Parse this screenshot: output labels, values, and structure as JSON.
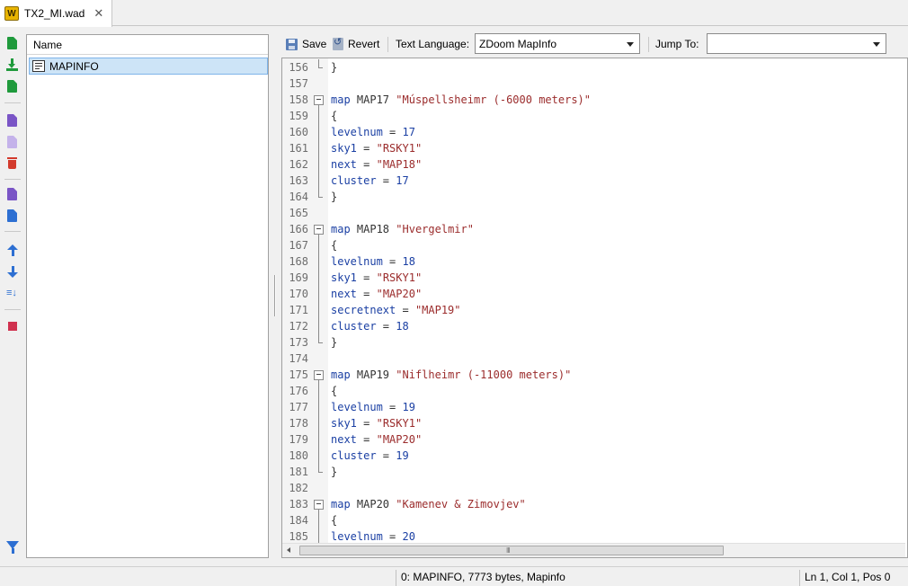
{
  "tab": {
    "title": "TX2_MI.wad",
    "icon": "wad-icon",
    "close_glyph": "✕",
    "wad_letter": "W"
  },
  "list": {
    "column_header": "Name",
    "entries": [
      {
        "name": "MAPINFO",
        "icon": "text-entry-icon",
        "selected": true
      }
    ]
  },
  "toolbar": {
    "save_label": "Save",
    "revert_label": "Revert",
    "text_language_label": "Text Language:",
    "text_language_value": "ZDoom MapInfo",
    "jump_to_label": "Jump To:",
    "jump_to_value": ""
  },
  "editor": {
    "lines": [
      {
        "n": "156",
        "fold": "end",
        "tokens": [
          {
            "t": "}",
            "c": "plain"
          }
        ]
      },
      {
        "n": "157",
        "fold": "none",
        "tokens": []
      },
      {
        "n": "158",
        "fold": "box",
        "tokens": [
          {
            "t": "map",
            "c": "kw"
          },
          {
            "t": " MAP17 ",
            "c": "plain"
          },
          {
            "t": "\"Múspellsheimr (-6000 meters)\"",
            "c": "str"
          }
        ]
      },
      {
        "n": "159",
        "fold": "bar",
        "tokens": [
          {
            "t": "{",
            "c": "plain"
          }
        ]
      },
      {
        "n": "160",
        "fold": "bar",
        "tokens": [
          {
            "t": "levelnum",
            "c": "prop"
          },
          {
            "t": " = ",
            "c": "plain"
          },
          {
            "t": "17",
            "c": "num"
          }
        ]
      },
      {
        "n": "161",
        "fold": "bar",
        "tokens": [
          {
            "t": "sky1",
            "c": "prop"
          },
          {
            "t": " = ",
            "c": "plain"
          },
          {
            "t": "\"RSKY1\"",
            "c": "str"
          }
        ]
      },
      {
        "n": "162",
        "fold": "bar",
        "tokens": [
          {
            "t": "next",
            "c": "prop"
          },
          {
            "t": " = ",
            "c": "plain"
          },
          {
            "t": "\"MAP18\"",
            "c": "str"
          }
        ]
      },
      {
        "n": "163",
        "fold": "bar",
        "tokens": [
          {
            "t": "cluster",
            "c": "prop"
          },
          {
            "t": " = ",
            "c": "plain"
          },
          {
            "t": "17",
            "c": "num"
          }
        ]
      },
      {
        "n": "164",
        "fold": "end",
        "tokens": [
          {
            "t": "}",
            "c": "plain"
          }
        ]
      },
      {
        "n": "165",
        "fold": "none",
        "tokens": []
      },
      {
        "n": "166",
        "fold": "box",
        "tokens": [
          {
            "t": "map",
            "c": "kw"
          },
          {
            "t": " MAP18 ",
            "c": "plain"
          },
          {
            "t": "\"Hvergelmir\"",
            "c": "str"
          }
        ]
      },
      {
        "n": "167",
        "fold": "bar",
        "tokens": [
          {
            "t": "{",
            "c": "plain"
          }
        ]
      },
      {
        "n": "168",
        "fold": "bar",
        "tokens": [
          {
            "t": "levelnum",
            "c": "prop"
          },
          {
            "t": " = ",
            "c": "plain"
          },
          {
            "t": "18",
            "c": "num"
          }
        ]
      },
      {
        "n": "169",
        "fold": "bar",
        "tokens": [
          {
            "t": "sky1",
            "c": "prop"
          },
          {
            "t": " = ",
            "c": "plain"
          },
          {
            "t": "\"RSKY1\"",
            "c": "str"
          }
        ]
      },
      {
        "n": "170",
        "fold": "bar",
        "tokens": [
          {
            "t": "next",
            "c": "prop"
          },
          {
            "t": " = ",
            "c": "plain"
          },
          {
            "t": "\"MAP20\"",
            "c": "str"
          }
        ]
      },
      {
        "n": "171",
        "fold": "bar",
        "tokens": [
          {
            "t": "secretnext",
            "c": "prop"
          },
          {
            "t": " = ",
            "c": "plain"
          },
          {
            "t": "\"MAP19\"",
            "c": "str"
          }
        ]
      },
      {
        "n": "172",
        "fold": "bar",
        "tokens": [
          {
            "t": "cluster",
            "c": "prop"
          },
          {
            "t": " = ",
            "c": "plain"
          },
          {
            "t": "18",
            "c": "num"
          }
        ]
      },
      {
        "n": "173",
        "fold": "end",
        "tokens": [
          {
            "t": "}",
            "c": "plain"
          }
        ]
      },
      {
        "n": "174",
        "fold": "none",
        "tokens": []
      },
      {
        "n": "175",
        "fold": "box",
        "tokens": [
          {
            "t": "map",
            "c": "kw"
          },
          {
            "t": " MAP19 ",
            "c": "plain"
          },
          {
            "t": "\"Niflheimr (-11000 meters)\"",
            "c": "str"
          }
        ]
      },
      {
        "n": "176",
        "fold": "bar",
        "tokens": [
          {
            "t": "{",
            "c": "plain"
          }
        ]
      },
      {
        "n": "177",
        "fold": "bar",
        "tokens": [
          {
            "t": "levelnum",
            "c": "prop"
          },
          {
            "t": " = ",
            "c": "plain"
          },
          {
            "t": "19",
            "c": "num"
          }
        ]
      },
      {
        "n": "178",
        "fold": "bar",
        "tokens": [
          {
            "t": "sky1",
            "c": "prop"
          },
          {
            "t": " = ",
            "c": "plain"
          },
          {
            "t": "\"RSKY1\"",
            "c": "str"
          }
        ]
      },
      {
        "n": "179",
        "fold": "bar",
        "tokens": [
          {
            "t": "next",
            "c": "prop"
          },
          {
            "t": " = ",
            "c": "plain"
          },
          {
            "t": "\"MAP20\"",
            "c": "str"
          }
        ]
      },
      {
        "n": "180",
        "fold": "bar",
        "tokens": [
          {
            "t": "cluster",
            "c": "prop"
          },
          {
            "t": " = ",
            "c": "plain"
          },
          {
            "t": "19",
            "c": "num"
          }
        ]
      },
      {
        "n": "181",
        "fold": "end",
        "tokens": [
          {
            "t": "}",
            "c": "plain"
          }
        ]
      },
      {
        "n": "182",
        "fold": "none",
        "tokens": []
      },
      {
        "n": "183",
        "fold": "box",
        "tokens": [
          {
            "t": "map",
            "c": "kw"
          },
          {
            "t": " MAP20 ",
            "c": "plain"
          },
          {
            "t": "\"Kamenev & Zimovjev\"",
            "c": "str"
          }
        ]
      },
      {
        "n": "184",
        "fold": "bar",
        "tokens": [
          {
            "t": "{",
            "c": "plain"
          }
        ]
      },
      {
        "n": "185",
        "fold": "bar",
        "tokens": [
          {
            "t": "levelnum",
            "c": "prop"
          },
          {
            "t": " = ",
            "c": "plain"
          },
          {
            "t": "20",
            "c": "num"
          }
        ]
      }
    ],
    "scroll_grip": "III"
  },
  "status": {
    "entry_info": "0: MAPINFO, 7773 bytes, Mapinfo",
    "cursor": "Ln 1, Col 1, Pos 0"
  },
  "colors": {
    "keyword": "#1a3fa3",
    "string": "#9b2c2c",
    "selection": "#cde4f7",
    "add_green": "#1f9a3c",
    "delete_red": "#d33a2c",
    "move_blue": "#2d6fd2",
    "bookmark_red": "#d0314f"
  },
  "sidebar_tools": [
    {
      "name": "new-entry-button",
      "icon": "new-file-icon"
    },
    {
      "name": "import-entry-button",
      "icon": "import-icon"
    },
    {
      "name": "import-files-button",
      "icon": "import-files-icon"
    },
    {
      "name": "rename-entry-button",
      "icon": "rename-icon"
    },
    {
      "name": "rename-each-button",
      "icon": "rename-each-icon"
    },
    {
      "name": "delete-entry-button",
      "icon": "trash-icon"
    },
    {
      "name": "export-entry-button",
      "icon": "export-icon"
    },
    {
      "name": "export-as-button",
      "icon": "export-as-icon"
    },
    {
      "name": "move-up-button",
      "icon": "arrow-up-icon"
    },
    {
      "name": "move-down-button",
      "icon": "arrow-down-icon"
    },
    {
      "name": "sort-entries-button",
      "icon": "sort-icon"
    },
    {
      "name": "bookmark-button",
      "icon": "bookmark-icon"
    },
    {
      "name": "filter-button",
      "icon": "filter-icon"
    }
  ]
}
